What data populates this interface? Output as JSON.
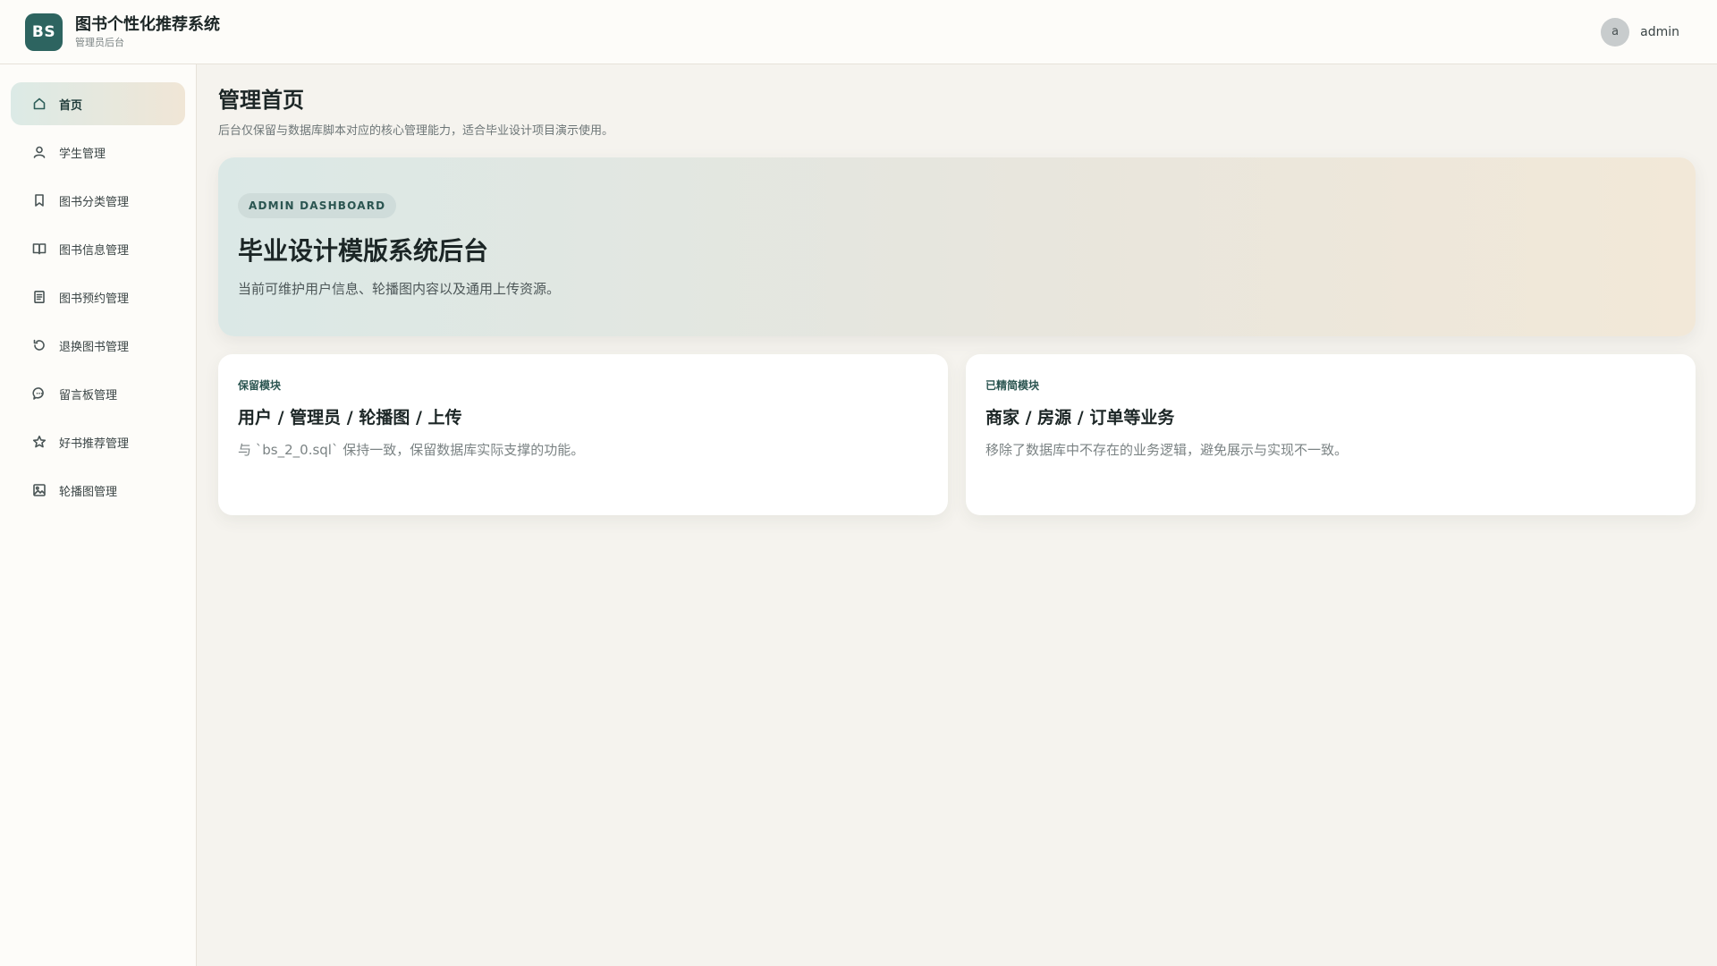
{
  "header": {
    "logo_text": "BS",
    "title": "图书个性化推荐系统",
    "subtitle": "管理员后台",
    "user": {
      "avatar_letter": "a",
      "name": "admin"
    }
  },
  "sidebar": {
    "items": [
      {
        "label": "首页",
        "icon": "home-icon",
        "active": true
      },
      {
        "label": "学生管理",
        "icon": "user-icon",
        "active": false
      },
      {
        "label": "图书分类管理",
        "icon": "bookmark-icon",
        "active": false
      },
      {
        "label": "图书信息管理",
        "icon": "book-open-icon",
        "active": false
      },
      {
        "label": "图书预约管理",
        "icon": "document-icon",
        "active": false
      },
      {
        "label": "退换图书管理",
        "icon": "refresh-icon",
        "active": false
      },
      {
        "label": "留言板管理",
        "icon": "message-icon",
        "active": false
      },
      {
        "label": "好书推荐管理",
        "icon": "star-icon",
        "active": false
      },
      {
        "label": "轮播图管理",
        "icon": "image-icon",
        "active": false
      }
    ]
  },
  "main": {
    "title": "管理首页",
    "description": "后台仅保留与数据库脚本对应的核心管理能力，适合毕业设计项目演示使用。",
    "hero": {
      "badge": "ADMIN DASHBOARD",
      "title": "毕业设计模版系统后台",
      "description": "当前可维护用户信息、轮播图内容以及通用上传资源。"
    },
    "cards": [
      {
        "tag": "保留模块",
        "title": "用户 / 管理员 / 轮播图 / 上传",
        "description": "与 `bs_2_0.sql` 保持一致，保留数据库实际支撑的功能。"
      },
      {
        "tag": "已精简模块",
        "title": "商家 / 房源 / 订单等业务",
        "description": "移除了数据库中不存在的业务逻辑，避免展示与实现不一致。"
      }
    ]
  },
  "colors": {
    "brand": "#2d6460",
    "background": "#f5f3ee",
    "accent_text": "#2b5551"
  }
}
